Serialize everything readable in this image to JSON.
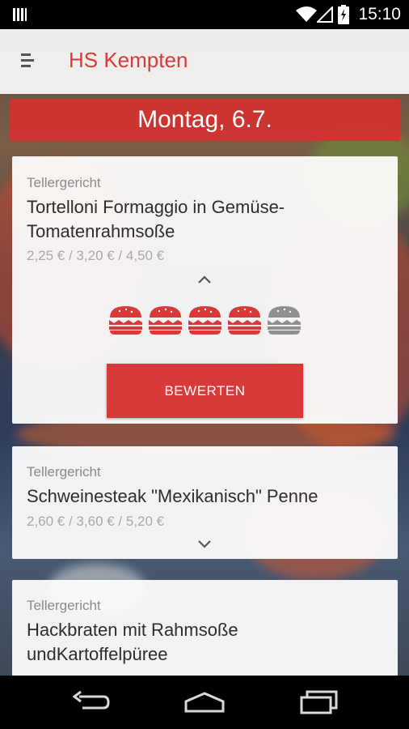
{
  "status_bar": {
    "time": "15:10"
  },
  "app_bar": {
    "title": "HS Kempten"
  },
  "date_banner": {
    "label": "Montag, 6.7."
  },
  "rating": {
    "value": 4,
    "max": 5,
    "button_label": "BEWERTEN"
  },
  "meals": [
    {
      "category": "Tellergericht",
      "name": "Tortelloni Formaggio in Gemüse-Tomatenrahmsoße",
      "prices": "2,25 € / 3,20 € / 4,50 €"
    },
    {
      "category": "Tellergericht",
      "name": "Schweinesteak \"Mexikanisch\" Penne",
      "prices": "2,60 € / 3,60 € / 5,20 €"
    },
    {
      "category": "Tellergericht",
      "name": "Hackbraten mit Rahmsoße undKartoffelpüree",
      "prices": ""
    }
  ],
  "colors": {
    "accent": "#d83a3a",
    "rating_active": "#d83a3a",
    "rating_inactive": "#8f8f8f"
  },
  "icons": {
    "menu": "hamburger-menu-icon",
    "expand": "chevron-down-icon",
    "collapse": "chevron-up-icon",
    "rating": "burger-icon"
  }
}
